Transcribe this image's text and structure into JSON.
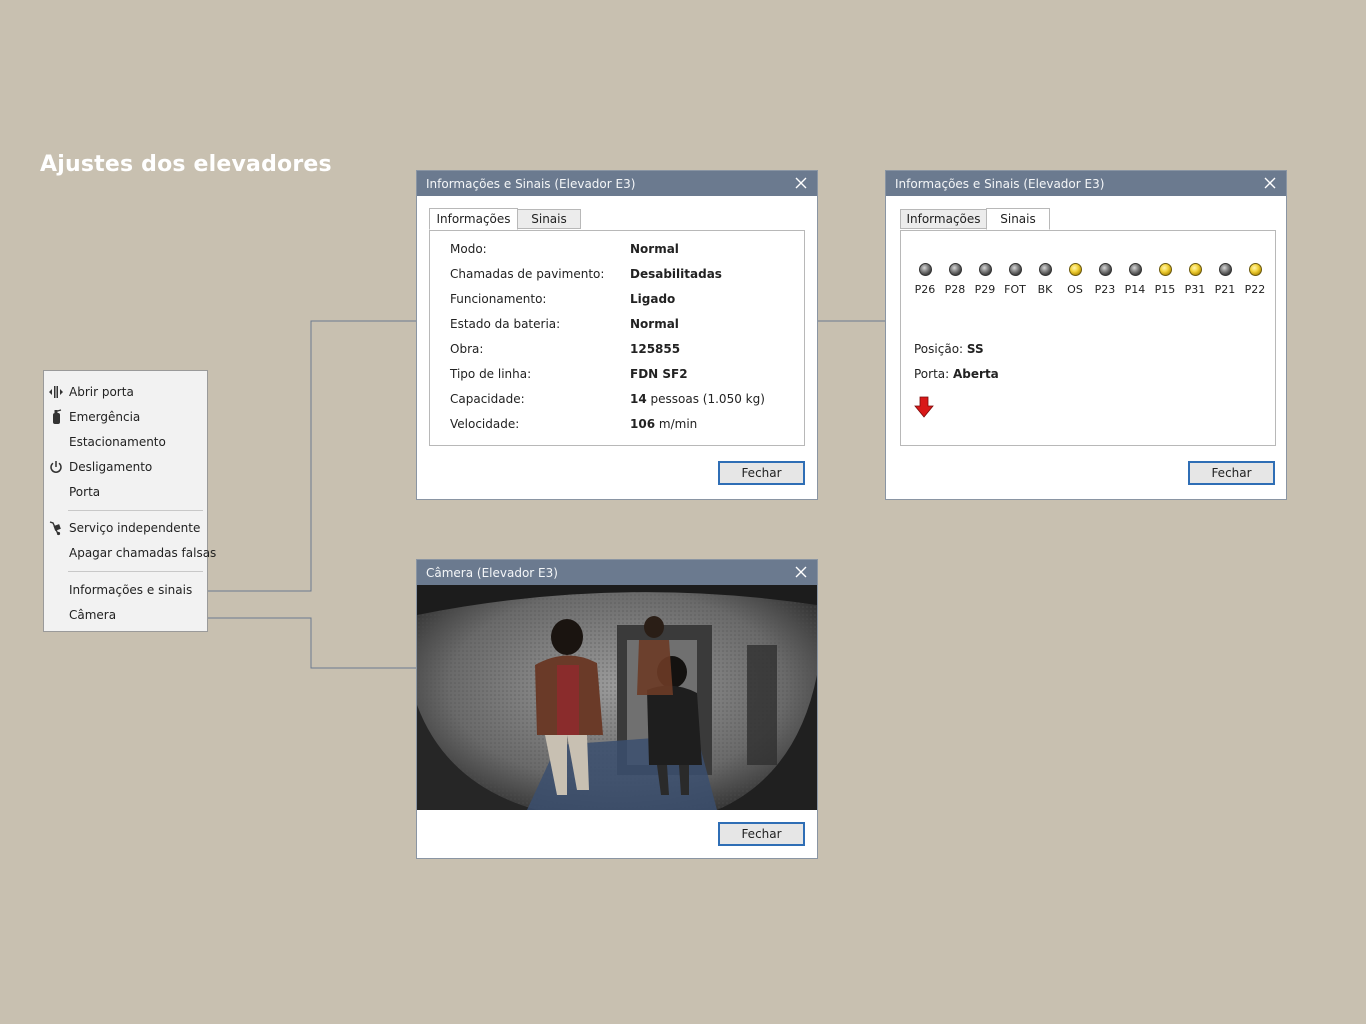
{
  "page": {
    "title": "Ajustes dos elevadores"
  },
  "menu": {
    "items": [
      {
        "label": "Abrir porta",
        "icon": "door-open-icon"
      },
      {
        "label": "Emergência",
        "icon": "fire-extinguisher-icon"
      },
      {
        "label": "Estacionamento",
        "icon": ""
      },
      {
        "label": "Desligamento",
        "icon": "power-icon"
      },
      {
        "label": "Porta",
        "icon": ""
      },
      {
        "label": "Serviço independente",
        "icon": "hand-truck-icon"
      },
      {
        "label": "Apagar chamadas falsas",
        "icon": ""
      },
      {
        "label": "Informações e sinais",
        "icon": ""
      },
      {
        "label": "Câmera",
        "icon": ""
      }
    ]
  },
  "info_dialog": {
    "title": "Informações e Sinais (Elevador E3)",
    "tabs": [
      "Informações",
      "Sinais"
    ],
    "active_tab": "Informações",
    "rows": [
      {
        "key": "Modo:",
        "value": "Normal",
        "unit": ""
      },
      {
        "key": "Chamadas de pavimento:",
        "value": "Desabilitadas",
        "unit": ""
      },
      {
        "key": "Funcionamento:",
        "value": "Ligado",
        "unit": ""
      },
      {
        "key": "Estado da bateria:",
        "value": "Normal",
        "unit": ""
      },
      {
        "key": "Obra:",
        "value": "125855",
        "unit": ""
      },
      {
        "key": "Tipo de linha:",
        "value": "FDN SF2",
        "unit": ""
      },
      {
        "key": "Capacidade:",
        "value": "14",
        "unit": "pessoas (1.050 kg)"
      },
      {
        "key": "Velocidade:",
        "value": "106",
        "unit": "m/min"
      }
    ],
    "button": "Fechar"
  },
  "signals_dialog": {
    "title": "Informações e Sinais (Elevador E3)",
    "tabs": [
      "Informações",
      "Sinais"
    ],
    "active_tab": "Sinais",
    "signals": [
      {
        "label": "P26",
        "on": false
      },
      {
        "label": "P28",
        "on": false
      },
      {
        "label": "P29",
        "on": false
      },
      {
        "label": "FOT",
        "on": false
      },
      {
        "label": "BK",
        "on": false
      },
      {
        "label": "OS",
        "on": true
      },
      {
        "label": "P23",
        "on": false
      },
      {
        "label": "P14",
        "on": false
      },
      {
        "label": "P15",
        "on": true
      },
      {
        "label": "P31",
        "on": true
      },
      {
        "label": "P21",
        "on": false
      },
      {
        "label": "P22",
        "on": true
      }
    ],
    "position_label": "Posição:",
    "position_value": "SS",
    "door_label": "Porta:",
    "door_value": "Aberta",
    "direction": "down",
    "direction_color": "#d81818",
    "button": "Fechar"
  },
  "camera_dialog": {
    "title": "Câmera (Elevador E3)",
    "button": "Fechar"
  },
  "colors": {
    "titlebar": "#6b7a8f",
    "background": "#c8c0b0",
    "button_border": "#2f6eb5",
    "led_on": "#f2d23a"
  }
}
